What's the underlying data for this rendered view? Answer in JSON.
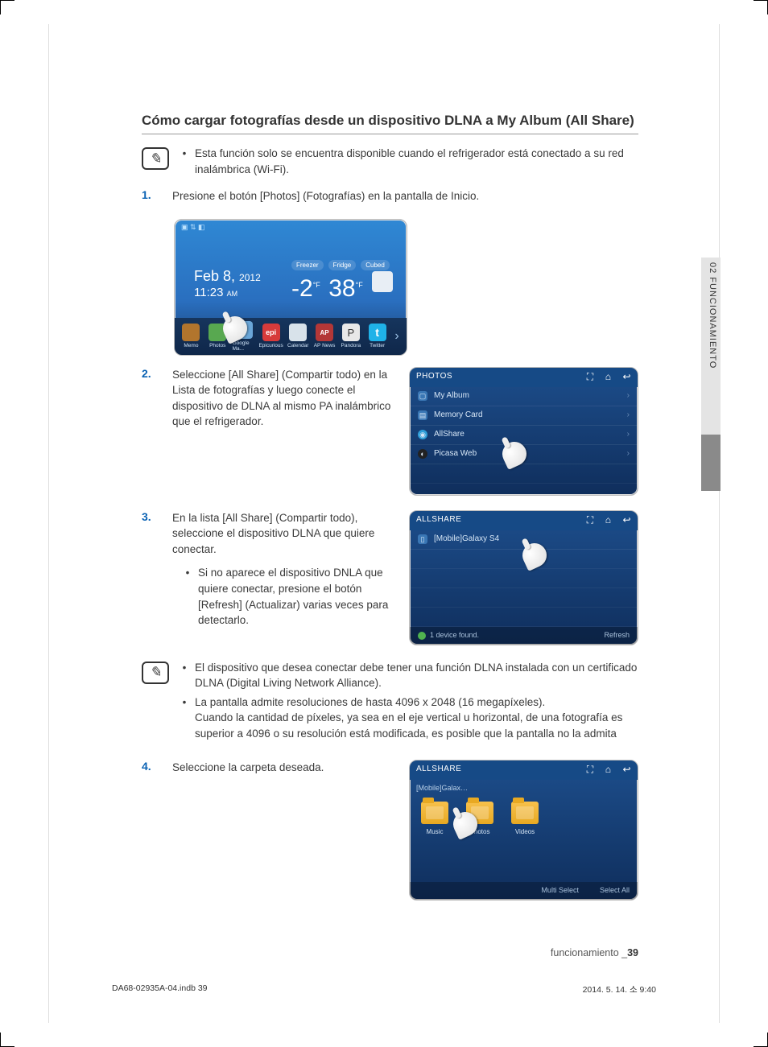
{
  "title": "Cómo cargar fotografías desde un dispositivo DLNA a My Album (All Share)",
  "top_note": "Esta función solo se encuentra disponible cuando el refrigerador está conectado a su red inalámbrica (Wi-Fi).",
  "side_tab": "02  FUNCIONAMIENTO",
  "steps": {
    "s1": {
      "num": "1.",
      "text": "Presione el botón [Photos] (Fotografías) en la pantalla de Inicio."
    },
    "s2": {
      "num": "2.",
      "text": "Seleccione [All Share] (Compartir todo) en la Lista de fotografías y luego conecte el dispositivo de DLNA al mismo PA inalámbrico que el refrigerador."
    },
    "s3": {
      "num": "3.",
      "text": "En la lista [All Share] (Compartir todo), seleccione el dispositivo DLNA que quiere conectar.",
      "sub": "Si no aparece el dispositivo DNLA que quiere conectar, presione el botón [Refresh] (Actualizar) varias veces para detectarlo."
    },
    "s4": {
      "num": "4.",
      "text": "Seleccione la carpeta deseada."
    }
  },
  "mid_notes": {
    "n1": "El dispositivo que desea conectar debe tener una función DLNA instalada con un certificado DLNA (Digital Living Network Alliance).",
    "n2a": "La pantalla admite resoluciones de hasta 4096 x 2048 (16 megapíxeles).",
    "n2b": "Cuando la cantidad de píxeles, ya sea en el eje vertical u horizontal, de una fotografía es superior a 4096 o su resolución está modificada, es posible que la pantalla no la admita"
  },
  "home": {
    "date": "Feb 8,",
    "year": "2012",
    "time": "11:23",
    "ampm": "AM",
    "chip_freezer": "Freezer",
    "chip_fridge": "Fridge",
    "chip_cubed": "Cubed",
    "temp1": "-2",
    "unit1": "°F",
    "temp2": "38",
    "unit2": "°F",
    "dock": {
      "memo": "Memo",
      "photos": "Photos",
      "map": "Google Ma...",
      "epi": "Epicurious",
      "epi_txt": "epi",
      "cal": "Calendar",
      "ap": "AP News",
      "ap_txt": "AP",
      "pan": "Pandora",
      "pan_txt": "P",
      "tw": "Twitter",
      "tw_txt": "t"
    }
  },
  "photos_panel": {
    "title": "PHOTOS",
    "rows": {
      "r1": "My Album",
      "r2": "Memory Card",
      "r3": "AllShare",
      "r4": "Picasa Web"
    }
  },
  "allshare_panel": {
    "title": "ALLSHARE",
    "device": "[Mobile]Galaxy S4",
    "found": "1 device found.",
    "refresh": "Refresh"
  },
  "allshare_folders": {
    "title": "ALLSHARE",
    "crumb": "[Mobile]Galax…",
    "f1": "Music",
    "f2": "Photos",
    "f3": "Videos",
    "multi": "Multi Select",
    "all": "Select All"
  },
  "footer": {
    "label": "funcionamiento _",
    "page": "39"
  },
  "print": {
    "left": "DA68-02935A-04.indb   39",
    "right": "2014. 5. 14.   소 9:40"
  }
}
